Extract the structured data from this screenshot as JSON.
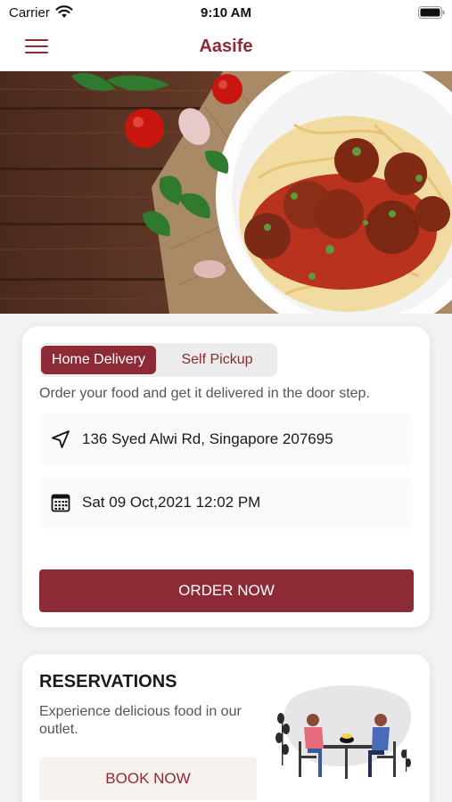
{
  "status_bar": {
    "carrier": "Carrier",
    "time": "9:10 AM"
  },
  "nav": {
    "title": "Aasife"
  },
  "hero": {
    "icon": "spaghetti-meatballs-photo"
  },
  "delivery": {
    "toggle": {
      "active": "Home Delivery",
      "inactive": "Self Pickup"
    },
    "description": "Order your food and get it delivered in the door step.",
    "address": "136 Syed Alwi Rd, Singapore 207695",
    "datetime": "Sat 09 Oct,2021 12:02 PM",
    "order_button": "ORDER NOW"
  },
  "reservations": {
    "title": "RESERVATIONS",
    "description": "Experience delicious food in our outlet.",
    "book_button": "BOOK NOW"
  },
  "colors": {
    "brand": "#8c2a35",
    "background": "#f2f2f2"
  }
}
